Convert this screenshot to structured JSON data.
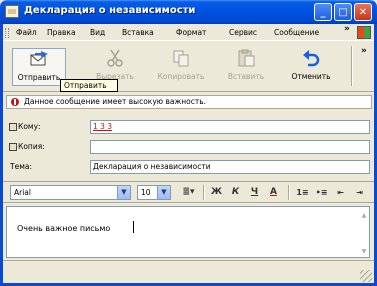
{
  "window": {
    "title": "Декларация о независимости"
  },
  "menu": {
    "items": [
      "Файл",
      "Правка",
      "Вид",
      "Вставка",
      "Формат",
      "Сервис",
      "Сообщение"
    ],
    "overflow": "»"
  },
  "toolbar": {
    "send": "Отправить",
    "cut": "Вырезать",
    "copy": "Копировать",
    "paste": "Вставить",
    "undo": "Отменить",
    "overflow": "»"
  },
  "tooltip": {
    "text": "Отправить"
  },
  "infobar": {
    "text": "Данное сообщение имеет высокую важность."
  },
  "header": {
    "to_label": "Кому:",
    "to_value": "1 3 3",
    "cc_label": "Копия:",
    "cc_value": "",
    "subject_label": "Тема:",
    "subject_value": "Декларация о независимости"
  },
  "format": {
    "font": "Arial",
    "size": "10",
    "buttons": [
      "Ж",
      "К",
      "Ч",
      "А"
    ]
  },
  "body": {
    "text": "Очень важное письмо"
  },
  "colors": {
    "titlebar": "#0054e3",
    "window_bg": "#ece9d8",
    "importance_icon": "#c41212",
    "recipient": "#c41212"
  }
}
